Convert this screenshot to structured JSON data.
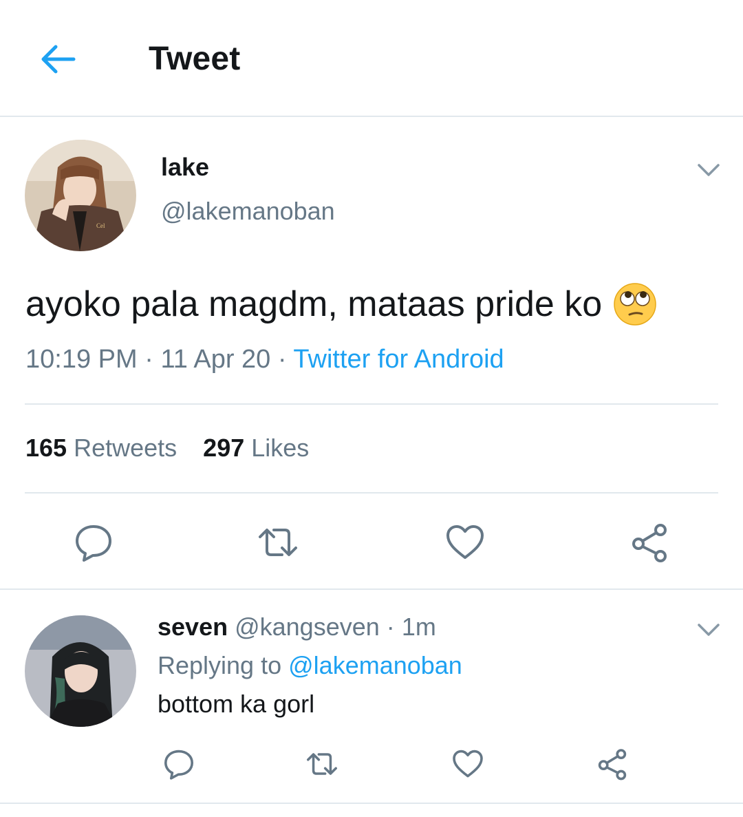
{
  "header": {
    "back_icon": "arrow-left-icon",
    "title": "Tweet",
    "accent_color": "#1da1f2"
  },
  "tweet": {
    "author_name": "lake",
    "author_handle": "@lakemanoban",
    "text": "ayoko pala magdm, mataas pride ko",
    "emoji": "face-with-rolling-eyes",
    "time": "10:19 PM",
    "dot": "·",
    "date": "11 Apr 20",
    "source": "Twitter for Android",
    "retweets_count": "165",
    "retweets_label": "Retweets",
    "likes_count": "297",
    "likes_label": "Likes",
    "actions": [
      "reply-icon",
      "retweet-icon",
      "like-icon",
      "share-icon"
    ]
  },
  "reply": {
    "author_name": "seven",
    "author_handle": "@kangseven",
    "dot": "·",
    "time": "1m",
    "replying_prefix": "Replying to",
    "replying_handle": "@lakemanoban",
    "text": "bottom ka gorl",
    "actions": [
      "reply-icon",
      "retweet-icon",
      "like-icon",
      "share-icon"
    ]
  },
  "colors": {
    "text_primary": "#14171a",
    "text_secondary": "#657786",
    "link": "#1da1f2",
    "divider": "#e1e8ed"
  }
}
